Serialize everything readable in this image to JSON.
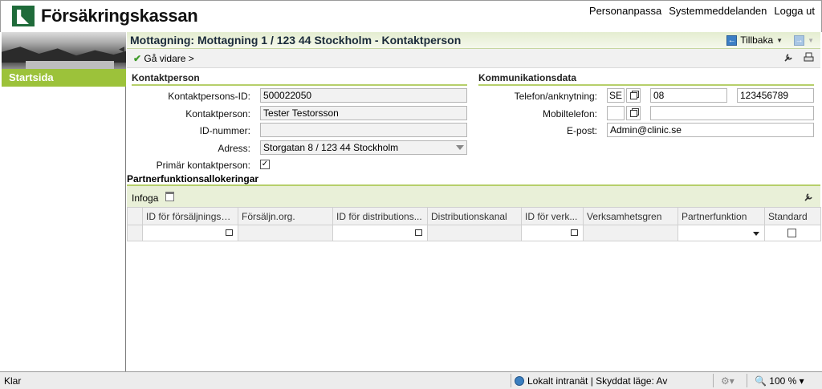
{
  "header": {
    "logo_text": "Försäkringskassan",
    "links": [
      "Personanpassa",
      "Systemmeddelanden",
      "Logga ut"
    ]
  },
  "sidebar": {
    "collapse_glyph": "◀",
    "items": [
      {
        "label": "Startsida"
      }
    ]
  },
  "title_bar": {
    "title": "Mottagning: Mottagning 1 / 123 44 Stockholm - Kontaktperson",
    "back_label": "Tillbaka",
    "back_icon": "←",
    "forward_icon": "→"
  },
  "action_bar": {
    "continue_label": "Gå vidare >",
    "check_glyph": "✔",
    "settings_icon": "wrench-icon",
    "print_icon": "print-icon"
  },
  "contact": {
    "section_title": "Kontaktperson",
    "id_label": "Kontaktpersons-ID:",
    "id_value": "500022050",
    "name_label": "Kontaktperson:",
    "name_value": "Tester Testorsson",
    "idnr_label": "ID-nummer:",
    "idnr_value": "",
    "address_label": "Adress:",
    "address_value": "Storgatan 8 / 123 44 Stockholm",
    "primary_label": "Primär kontaktperson:",
    "primary_checked": true
  },
  "communication": {
    "section_title": "Kommunikationsdata",
    "phone_label": "Telefon/anknytning:",
    "phone_country": "SE",
    "phone_area": "08",
    "phone_number": "123456789",
    "mobile_label": "Mobiltelefon:",
    "mobile_country": "",
    "mobile_number": "",
    "email_label": "E-post:",
    "email_value": "Admin@clinic.se"
  },
  "partner": {
    "title": "Partnerfunktionsallokeringar",
    "insert_label": "Infoga",
    "columns": [
      "ID för försäljningso...",
      "Försäljn.org.",
      "ID för distributions...",
      "Distributionskanal",
      "ID för verk...",
      "Verksamhetsgren",
      "Partnerfunktion",
      "Standard"
    ]
  },
  "status_bar": {
    "status": "Klar",
    "zone": "Lokalt intranät | Skyddat läge: Av",
    "zoom": "100 %"
  }
}
